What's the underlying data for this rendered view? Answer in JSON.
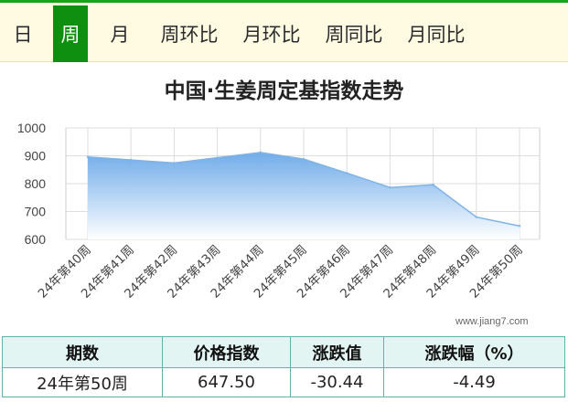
{
  "tabs": [
    {
      "label": "日",
      "active": false
    },
    {
      "label": "周",
      "active": true
    },
    {
      "label": "月",
      "active": false
    },
    {
      "label": "周环比",
      "active": false
    },
    {
      "label": "月环比",
      "active": false
    },
    {
      "label": "周同比",
      "active": false
    },
    {
      "label": "月同比",
      "active": false
    }
  ],
  "chart_data": {
    "type": "area",
    "title": "中国·生姜周定基指数走势",
    "categories": [
      "24年第40周",
      "24年第41周",
      "24年第42周",
      "24年第43周",
      "24年第44周",
      "24年第45周",
      "24年第46周",
      "24年第47周",
      "24年第48周",
      "24年第49周",
      "24年第50周"
    ],
    "series": [
      {
        "values": [
          896,
          885,
          874,
          893,
          912,
          888,
          838,
          786,
          796,
          680,
          648
        ]
      }
    ],
    "yticks": [
      "1000",
      "900",
      "800",
      "700",
      "600"
    ],
    "ylim": [
      600,
      1000
    ],
    "grid": true,
    "colors": {
      "line": "#7fb3e6",
      "fill_top": "#6aa8e8",
      "fill_bottom": "#ffffff",
      "grid": "#dddddd"
    }
  },
  "watermark": "www.jiang7.com",
  "summary": {
    "headers": [
      "期数",
      "价格指数",
      "涨跌值",
      "涨跌幅（%）"
    ],
    "row": [
      "24年第50周",
      "647.50",
      "-30.44",
      "-4.49"
    ]
  }
}
